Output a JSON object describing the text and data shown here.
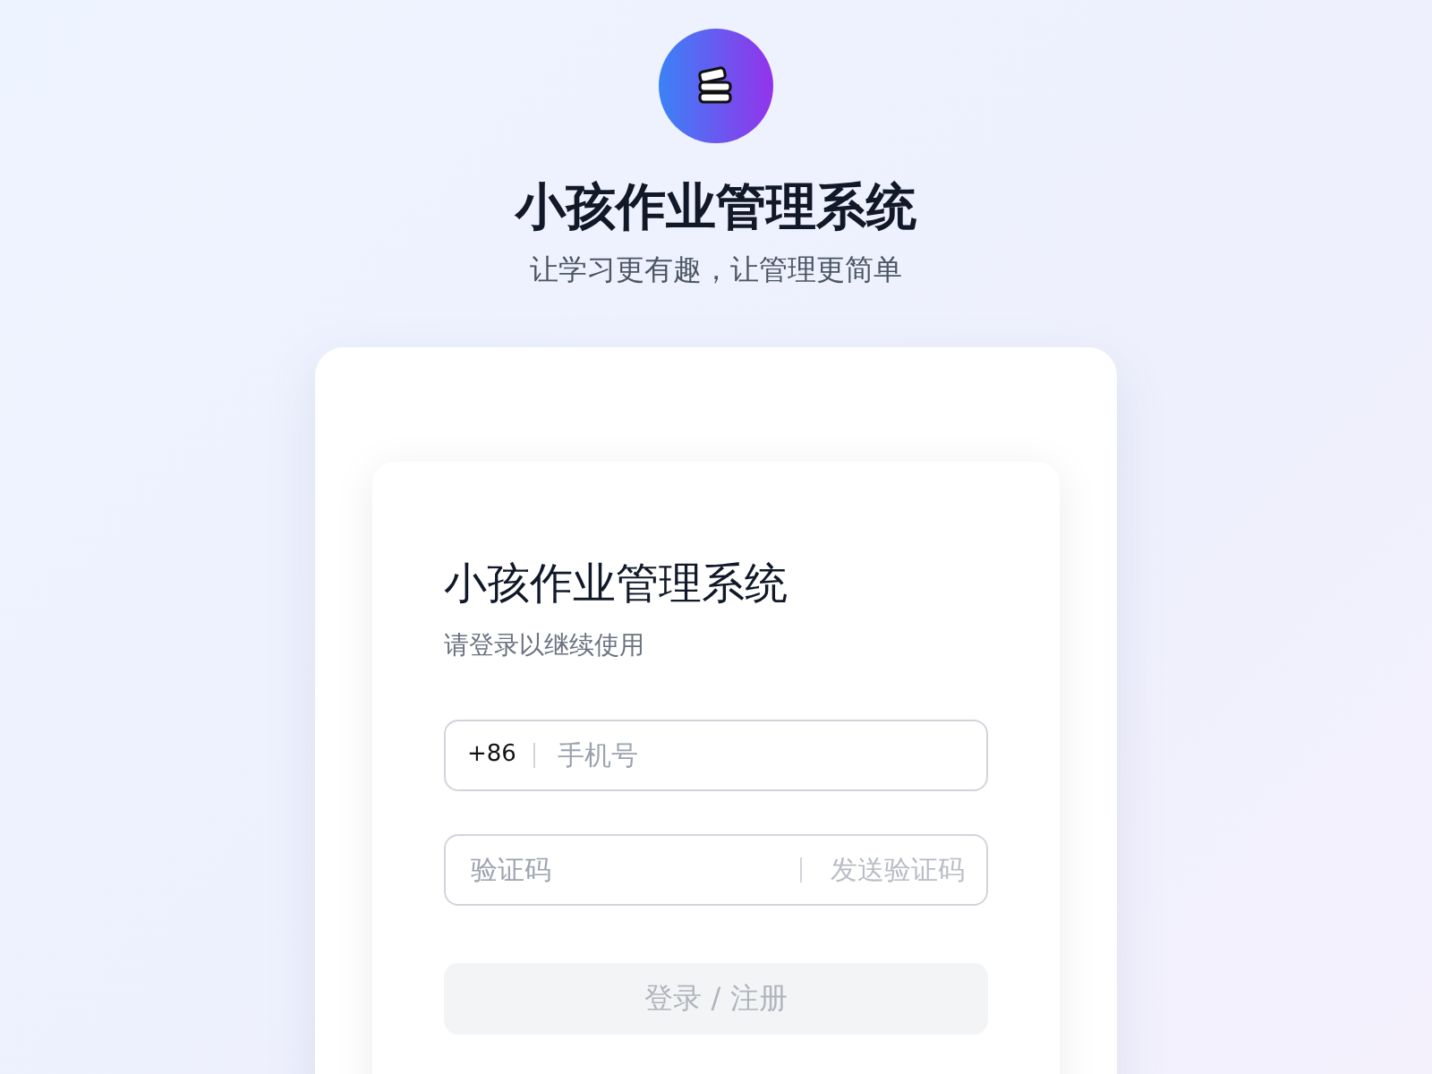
{
  "header": {
    "title": "小孩作业管理系统",
    "subtitle": "让学习更有趣，让管理更简单"
  },
  "login": {
    "title": "小孩作业管理系统",
    "subtitle": "请登录以继续使用",
    "phone": {
      "prefix": "+86",
      "placeholder": "手机号"
    },
    "code": {
      "placeholder": "验证码",
      "send_button": {
        "label": "发送验证码",
        "disabled": true
      }
    },
    "submit": {
      "label": "登录 / 注册",
      "disabled": true
    }
  }
}
